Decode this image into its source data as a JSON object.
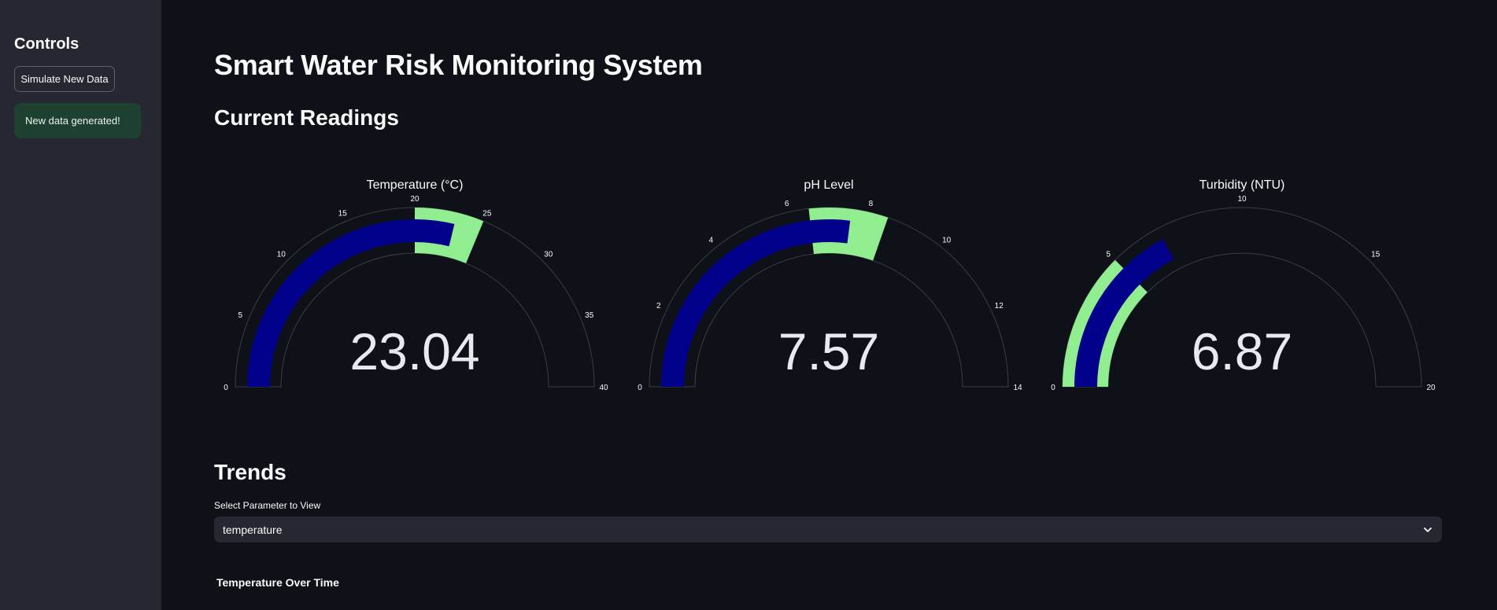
{
  "sidebar": {
    "heading": "Controls",
    "simulate_button": "Simulate New Data",
    "success_message": "New data generated!"
  },
  "main": {
    "title": "Smart Water Risk Monitoring System",
    "current_readings_heading": "Current Readings",
    "trends_heading": "Trends",
    "select_label": "Select Parameter to View",
    "select_value": "temperature",
    "chart_title": "Temperature Over Time"
  },
  "colors": {
    "background": "#0e1117",
    "sidebar": "#262730",
    "bar": "#00008b",
    "step": "#90ee90",
    "success_bg": "#1f4131"
  },
  "chart_data": [
    {
      "type": "gauge",
      "title": "Temperature (°C)",
      "value": 23.04,
      "value_label": "23.04",
      "range": [
        0,
        40
      ],
      "ticks": [
        0,
        5,
        10,
        15,
        20,
        25,
        30,
        35,
        40
      ],
      "green_band": [
        20,
        25
      ]
    },
    {
      "type": "gauge",
      "title": "pH Level",
      "value": 7.57,
      "value_label": "7.57",
      "range": [
        0,
        14
      ],
      "ticks": [
        0,
        2,
        4,
        6,
        8,
        10,
        12,
        14
      ],
      "green_band": [
        6.5,
        8.5
      ]
    },
    {
      "type": "gauge",
      "title": "Turbidity (NTU)",
      "value": 6.87,
      "value_label": "6.87",
      "range": [
        0,
        20
      ],
      "ticks": [
        0,
        5,
        10,
        15,
        20
      ],
      "green_band": [
        0,
        5
      ]
    }
  ]
}
